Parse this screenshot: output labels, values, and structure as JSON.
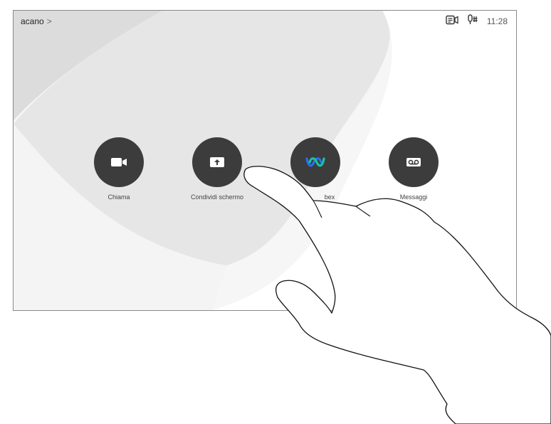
{
  "topbar": {
    "device_name": "acano",
    "chevron": ">",
    "icons": [
      "camera-control-icon",
      "microphone-icon"
    ],
    "time": "11:28"
  },
  "tiles": [
    {
      "label": "Chiama",
      "icon": "video-camera-icon"
    },
    {
      "label": "Condividi schermo",
      "icon": "share-screen-icon"
    },
    {
      "label": "bex",
      "icon": "webex-icon"
    },
    {
      "label": "Messaggi",
      "icon": "voicemail-icon"
    }
  ],
  "colors": {
    "tile_bg": "#3c3c3c",
    "screen_bg": "#f4f4f4",
    "webex_blue": "#2a6df4",
    "webex_green": "#19c4a0"
  }
}
